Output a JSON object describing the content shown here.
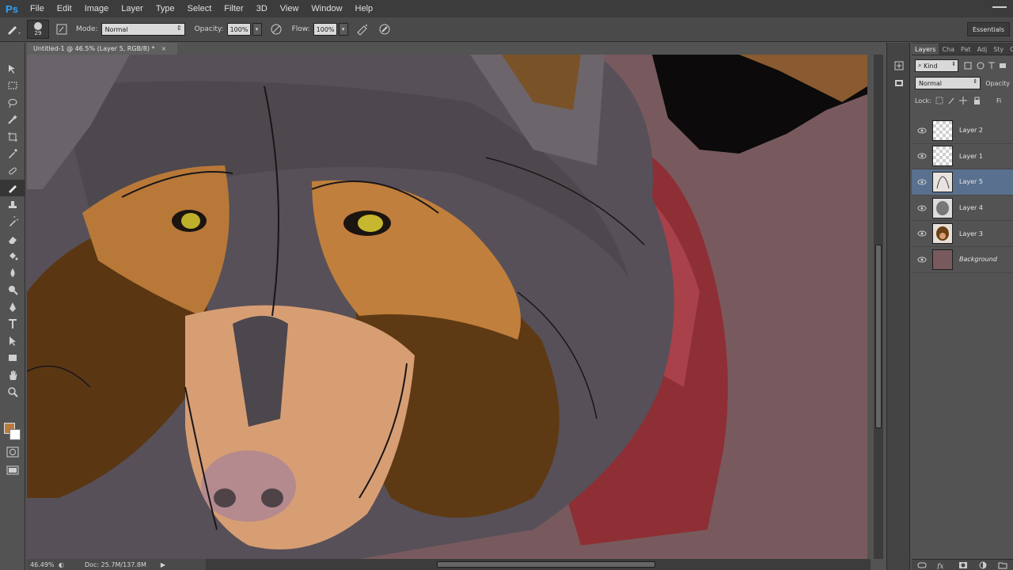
{
  "app": {
    "logo": "Ps"
  },
  "menu": [
    "File",
    "Edit",
    "Image",
    "Layer",
    "Type",
    "Select",
    "Filter",
    "3D",
    "View",
    "Window",
    "Help"
  ],
  "options": {
    "brush_size": "29",
    "mode_label": "Mode:",
    "mode_value": "Normal",
    "opacity_label": "Opacity:",
    "opacity_value": "100%",
    "flow_label": "Flow:",
    "flow_value": "100%",
    "workspace": "Essentials"
  },
  "document": {
    "tab_title": "Untitled-1 @ 46.5% (Layer 5, RGB/8) *",
    "close": "×"
  },
  "status": {
    "zoom": "46.49%",
    "doc_size": "Doc: 25.7M/137.8M"
  },
  "colors": {
    "foreground": "#b97a3e",
    "background": "#ffffff",
    "canvas_bg": "#785a5e",
    "selection": "#59708e"
  },
  "layers_panel": {
    "tabs": [
      "Layers",
      "Cha",
      "Pat",
      "Adj",
      "Sty",
      "Co"
    ],
    "kind": "Kind",
    "blend": "Normal",
    "opacity_label": "Opacity",
    "lock_label": "Lock:",
    "fill_label": "Fi",
    "layers": [
      {
        "name": "Layer 2",
        "selected": false
      },
      {
        "name": "Layer 1",
        "selected": false
      },
      {
        "name": "Layer 5",
        "selected": true
      },
      {
        "name": "Layer 4",
        "selected": false
      },
      {
        "name": "Layer 3",
        "selected": false
      },
      {
        "name": "Background",
        "selected": false
      }
    ]
  },
  "tools": [
    "move-tool",
    "marquee-tool",
    "lasso-tool",
    "quick-select-tool",
    "crop-tool",
    "eyedropper-tool",
    "healing-tool",
    "brush-tool",
    "clone-stamp-tool",
    "history-brush-tool",
    "eraser-tool",
    "paint-bucket-tool",
    "blur-tool",
    "dodge-tool",
    "pen-tool",
    "type-tool",
    "path-select-tool",
    "rectangle-tool",
    "hand-tool",
    "zoom-tool"
  ]
}
